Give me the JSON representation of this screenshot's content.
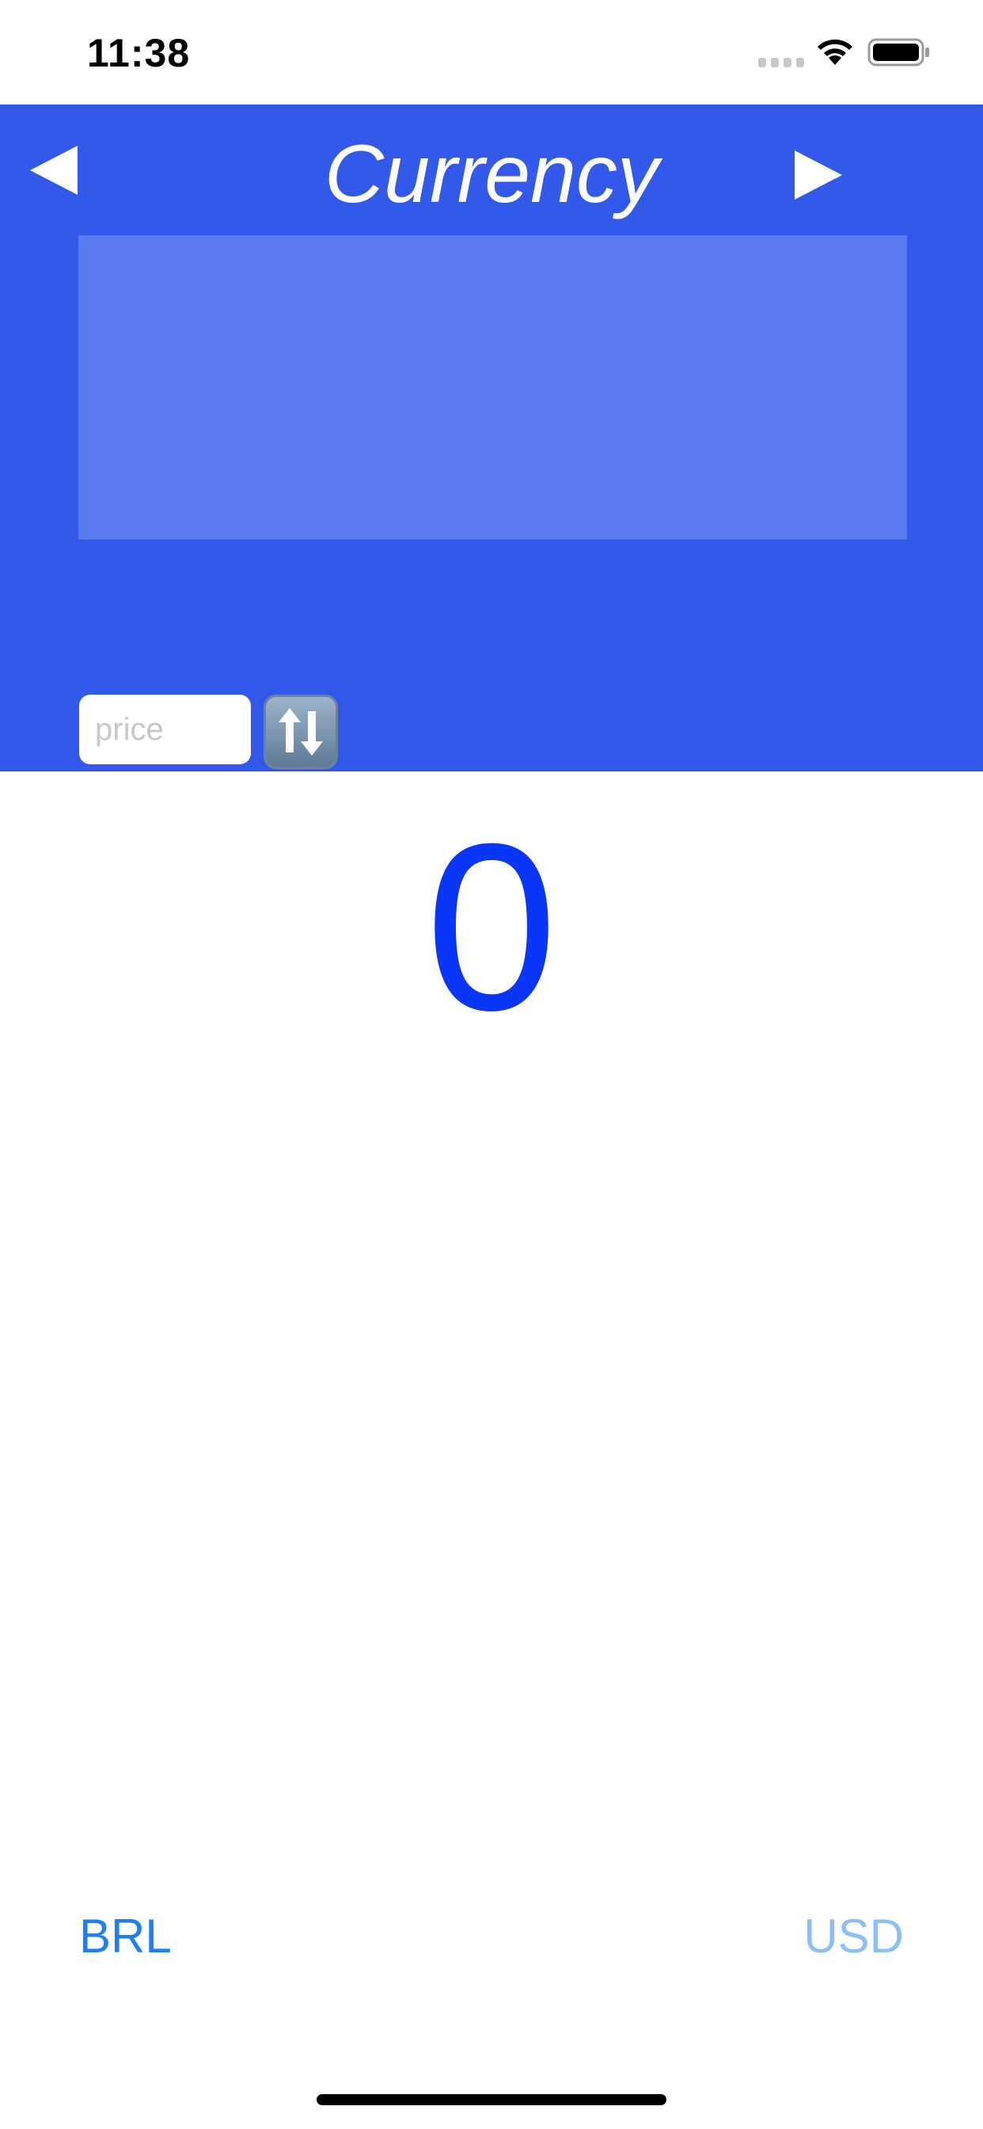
{
  "status_bar": {
    "time": "11:38"
  },
  "header": {
    "title": "Currency",
    "prev_icon": "triangle-left-icon",
    "next_icon": "triangle-right-icon",
    "background_color": "#3259ea",
    "panel_color": "#5a7bef"
  },
  "price_input": {
    "value": "",
    "placeholder": "price"
  },
  "swap_button": {
    "icon": "swap-arrows-icon"
  },
  "result": {
    "value": "0",
    "color": "#0a36f7"
  },
  "currencies": {
    "from": "BRL",
    "to": "USD",
    "from_color": "#1e7ef5",
    "to_color": "#8dbff7"
  }
}
